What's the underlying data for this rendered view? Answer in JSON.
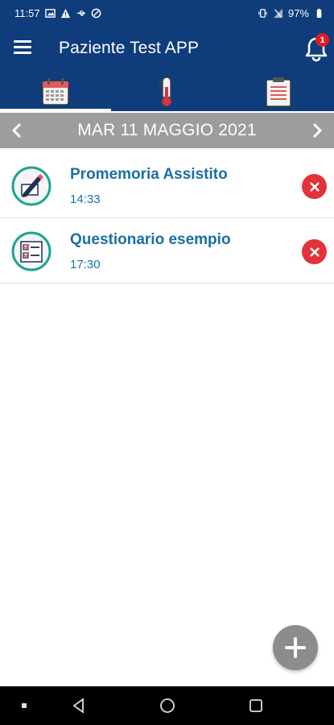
{
  "status_bar": {
    "time": "11:57",
    "battery": "97%"
  },
  "app_bar": {
    "title": "Paziente Test APP",
    "notification_count": "1"
  },
  "tabs": [
    {
      "name": "calendar-icon",
      "active": true
    },
    {
      "name": "thermometer-icon",
      "active": false
    },
    {
      "name": "clipboard-icon",
      "active": false
    }
  ],
  "date_bar": {
    "date": "MAR 11 MAGGIO 2021"
  },
  "items": [
    {
      "title": "Promemoria Assistito",
      "time": "14:33",
      "icon": "pencil-note-icon"
    },
    {
      "title": "Questionario esempio",
      "time": "17:30",
      "icon": "checklist-icon"
    }
  ],
  "colors": {
    "primary": "#0f3c7a",
    "date_bar": "#9d9d9d",
    "item_text": "#1a6fa5",
    "delete": "#e2323a",
    "badge": "#e31b23",
    "icon_ring": "#1aa58f",
    "fab": "#8c8c8c"
  }
}
